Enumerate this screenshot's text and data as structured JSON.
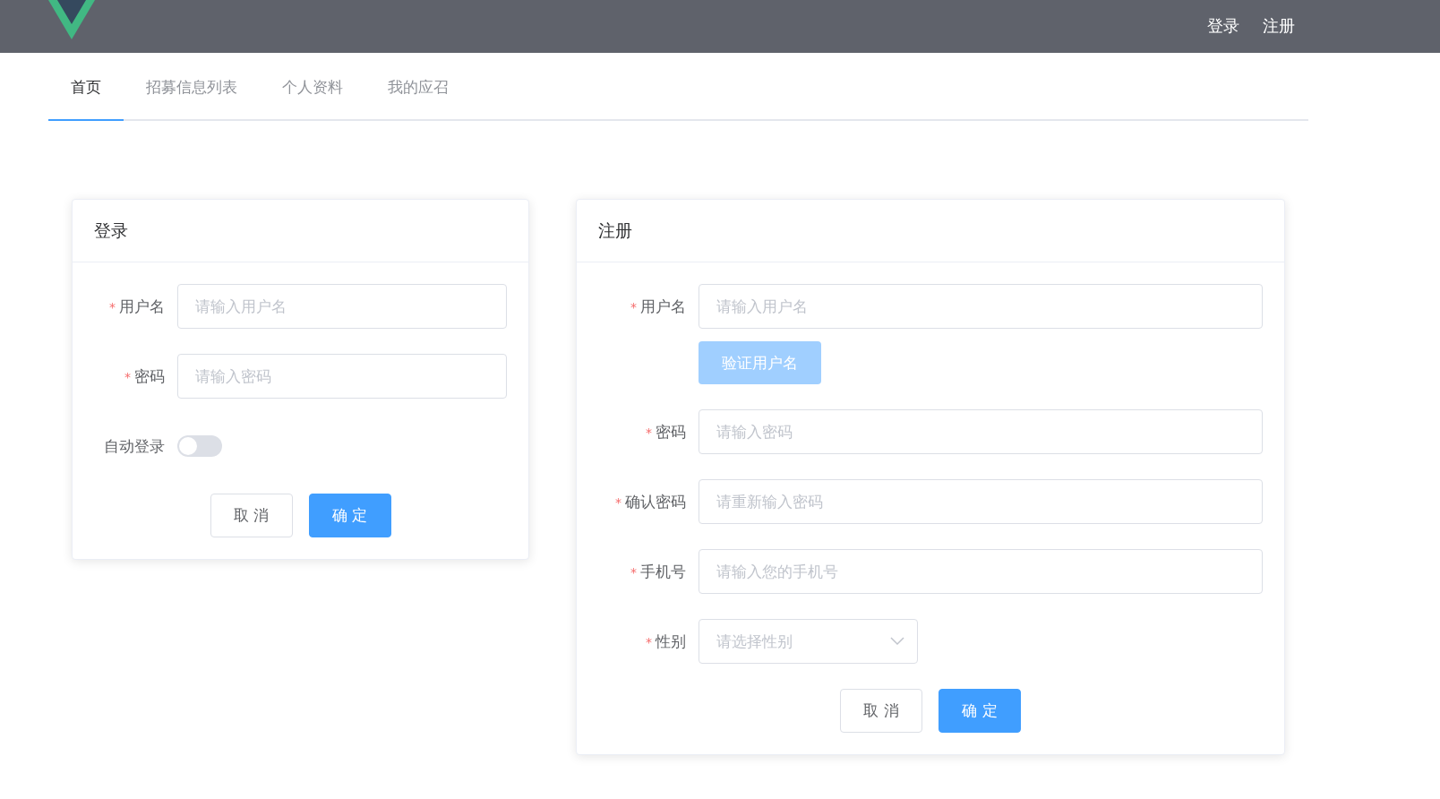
{
  "header": {
    "links": [
      "登录",
      "注册"
    ]
  },
  "tabs": [
    {
      "label": "首页",
      "selected": true
    },
    {
      "label": "招募信息列表",
      "selected": false
    },
    {
      "label": "个人资料",
      "selected": false
    },
    {
      "label": "我的应召",
      "selected": false
    }
  ],
  "login_card": {
    "title": "登录",
    "fields": [
      {
        "kind": "input",
        "label": "用户名",
        "required_mark": "*",
        "placeholder": "请输入用户名"
      },
      {
        "kind": "input",
        "label": "密码",
        "required_mark": "*",
        "placeholder": "请输入密码"
      },
      {
        "kind": "switch",
        "label": "自动登录",
        "on": false
      }
    ],
    "buttons": [
      {
        "label": "取 消",
        "primary": false
      },
      {
        "label": "确 定",
        "primary": true
      }
    ]
  },
  "register_card": {
    "title": "注册",
    "fields": [
      {
        "kind": "input",
        "label": "用户名",
        "required_mark": "*",
        "placeholder": "请输入用户名",
        "action": {
          "label": "验证用户名",
          "disabled": true
        }
      },
      {
        "kind": "input",
        "label": "密码",
        "required_mark": "*",
        "placeholder": "请输入密码"
      },
      {
        "kind": "input",
        "label": "确认密码",
        "required_mark": "*",
        "placeholder": "请重新输入密码"
      },
      {
        "kind": "input",
        "label": "手机号",
        "required_mark": "*",
        "placeholder": "请输入您的手机号"
      },
      {
        "kind": "select",
        "label": "性别",
        "required_mark": "*",
        "placeholder": "请选择性别"
      }
    ],
    "buttons": [
      {
        "label": "取 消",
        "primary": false
      },
      {
        "label": "确 定",
        "primary": true
      }
    ]
  }
}
